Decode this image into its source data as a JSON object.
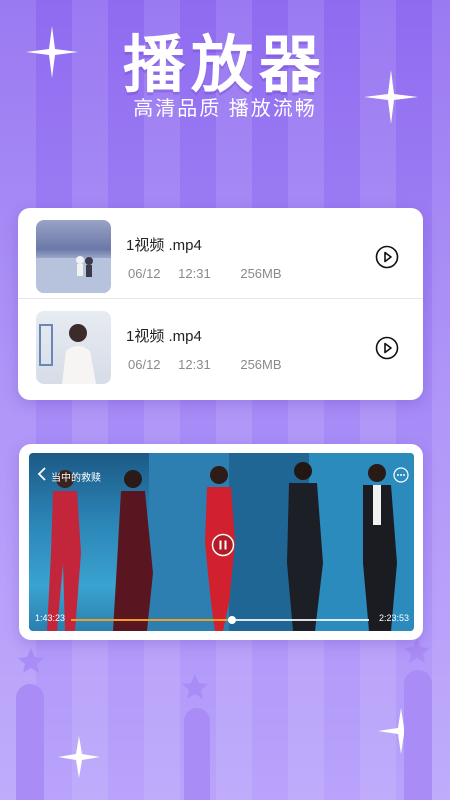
{
  "hero": {
    "title": "播放器",
    "subtitle": "高清品质 播放流畅"
  },
  "files": [
    {
      "name": "1视频 .mp4",
      "date": "06/12",
      "time": "12:31",
      "size": "256MB",
      "thumb_icon": "video-thumbnail"
    },
    {
      "name": "1视频 .mp4",
      "date": "06/12",
      "time": "12:31",
      "size": "256MB",
      "thumb_icon": "video-thumbnail"
    }
  ],
  "player": {
    "title": "当中的救赎",
    "current_time": "1:43:23",
    "total_time": "2:23:53",
    "progress": 0.54,
    "state": "playing",
    "accent": "#f0a028"
  },
  "colors": {
    "background": "#a488f6",
    "card": "#ffffff",
    "text_primary": "#222222",
    "text_secondary": "#8a8a8a"
  }
}
